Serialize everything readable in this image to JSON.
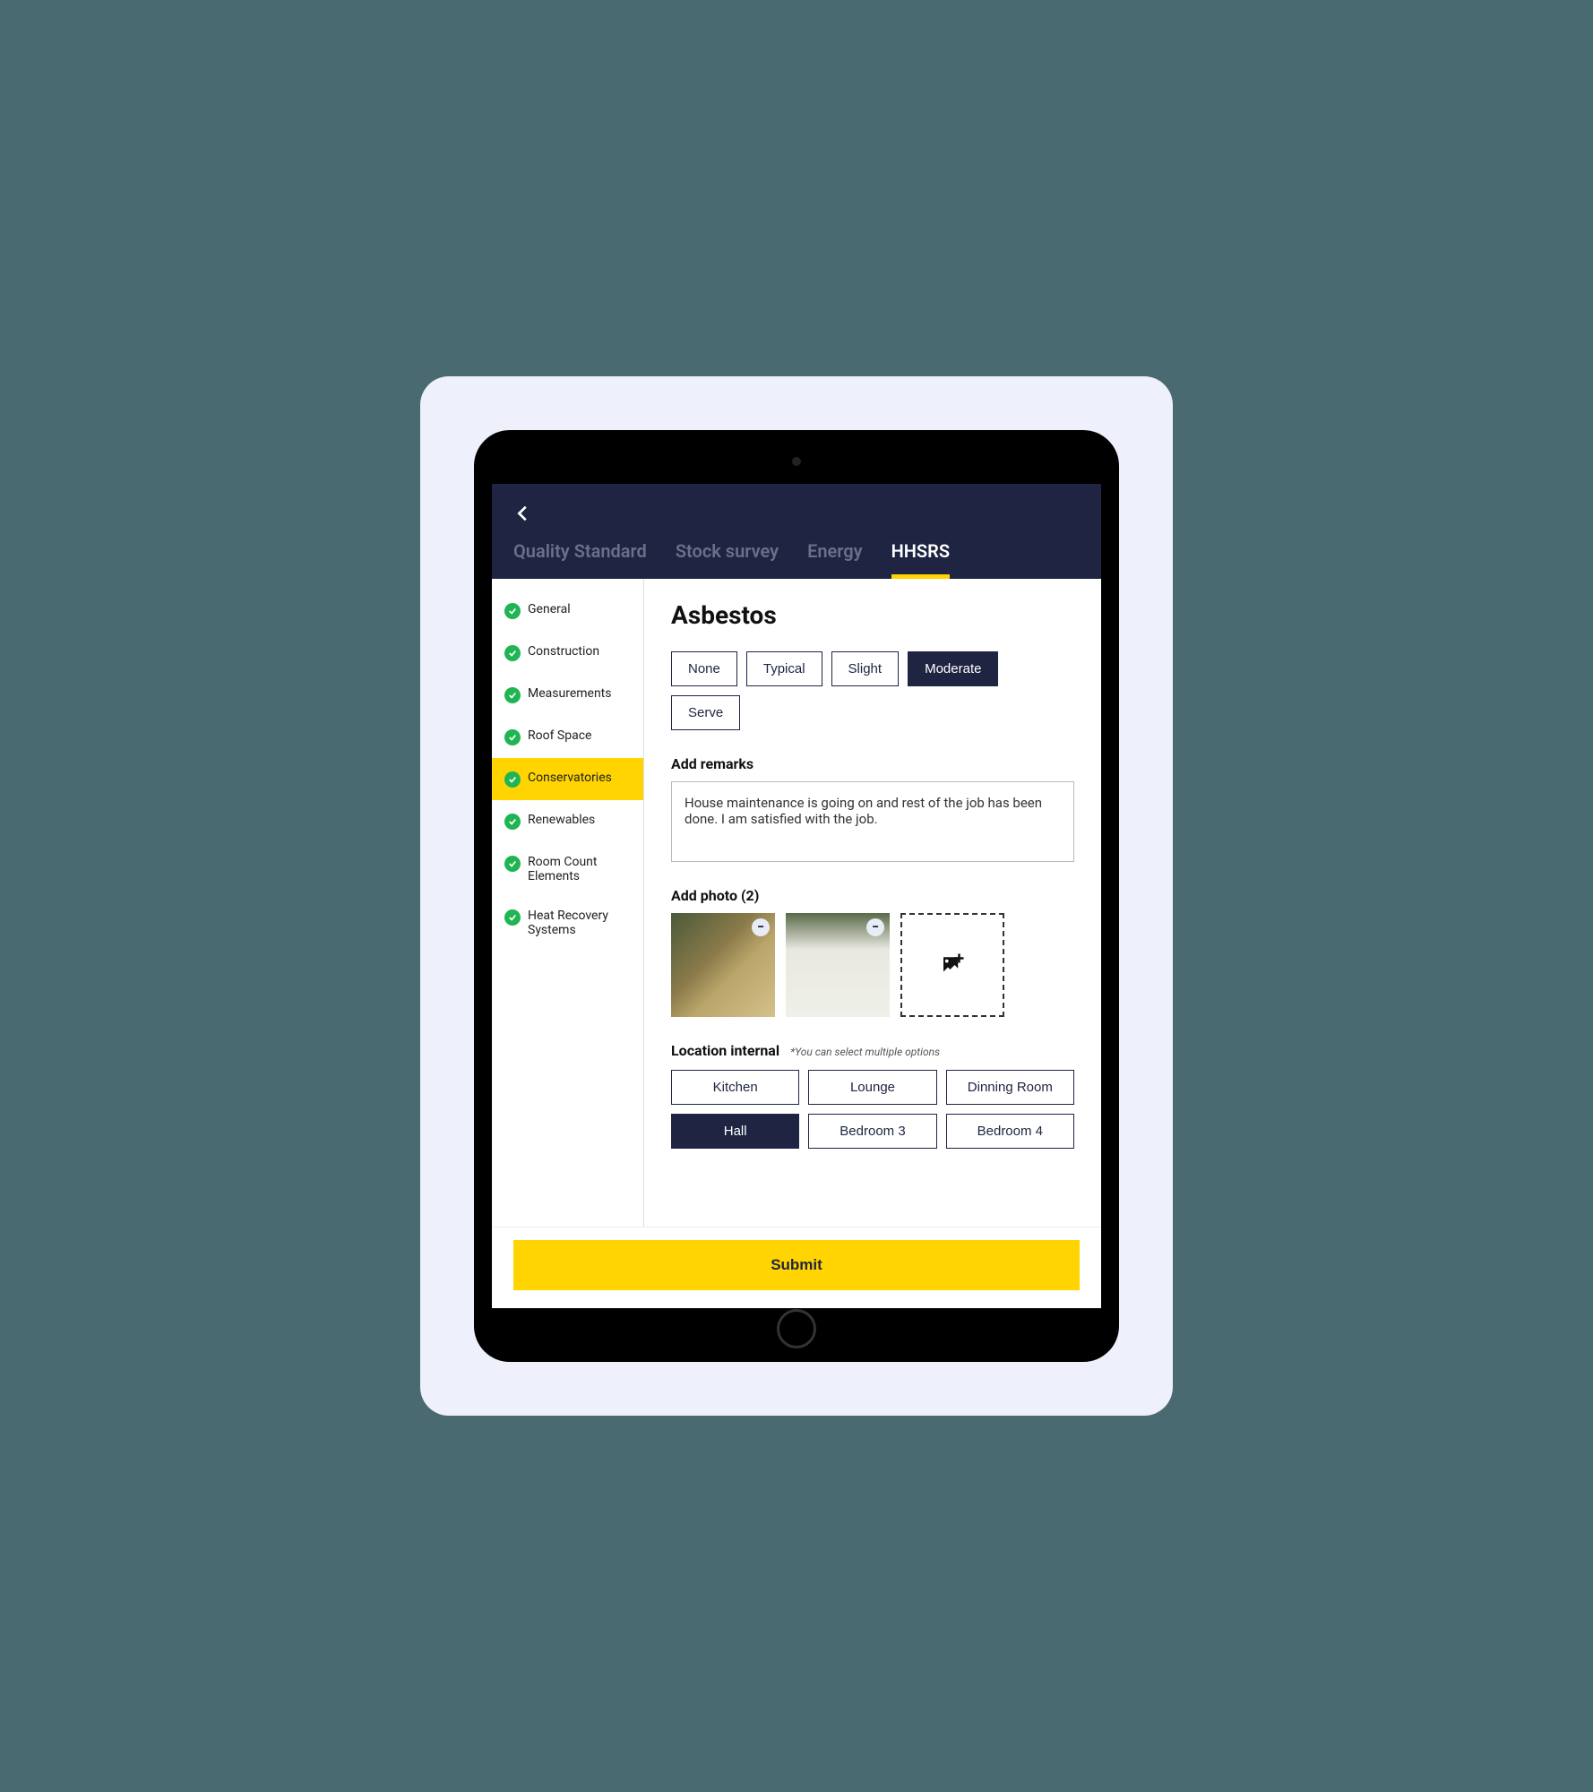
{
  "tabs": [
    {
      "label": "Quality Standard",
      "active": false
    },
    {
      "label": "Stock survey",
      "active": false
    },
    {
      "label": "Energy",
      "active": false
    },
    {
      "label": "HHSRS",
      "active": true
    }
  ],
  "sidebar": {
    "items": [
      {
        "label": "General",
        "active": false
      },
      {
        "label": "Construction",
        "active": false
      },
      {
        "label": "Measurements",
        "active": false
      },
      {
        "label": "Roof Space",
        "active": false
      },
      {
        "label": "Conservatories",
        "active": true
      },
      {
        "label": "Renewables",
        "active": false
      },
      {
        "label": "Room Count Elements",
        "active": false
      },
      {
        "label": "Heat Recovery Systems",
        "active": false
      }
    ]
  },
  "main": {
    "title": "Asbestos",
    "severity_options": [
      {
        "label": "None",
        "selected": false
      },
      {
        "label": "Typical",
        "selected": false
      },
      {
        "label": "Slight",
        "selected": false
      },
      {
        "label": "Moderate",
        "selected": true
      },
      {
        "label": "Serve",
        "selected": false
      }
    ],
    "remarks_label": "Add remarks",
    "remarks_value": "House maintenance is going on and rest of the job has been done. I am satisfied with the job.",
    "photo_label": "Add photo (2)",
    "photo_count": 2,
    "location_label": "Location internal",
    "location_hint": "*You can select multiple options",
    "location_options": [
      {
        "label": "Kitchen",
        "selected": false
      },
      {
        "label": "Lounge",
        "selected": false
      },
      {
        "label": "Dinning Room",
        "selected": false
      },
      {
        "label": "Hall",
        "selected": true
      },
      {
        "label": "Bedroom 3",
        "selected": false
      },
      {
        "label": "Bedroom 4",
        "selected": false
      }
    ]
  },
  "footer": {
    "submit_label": "Submit"
  }
}
